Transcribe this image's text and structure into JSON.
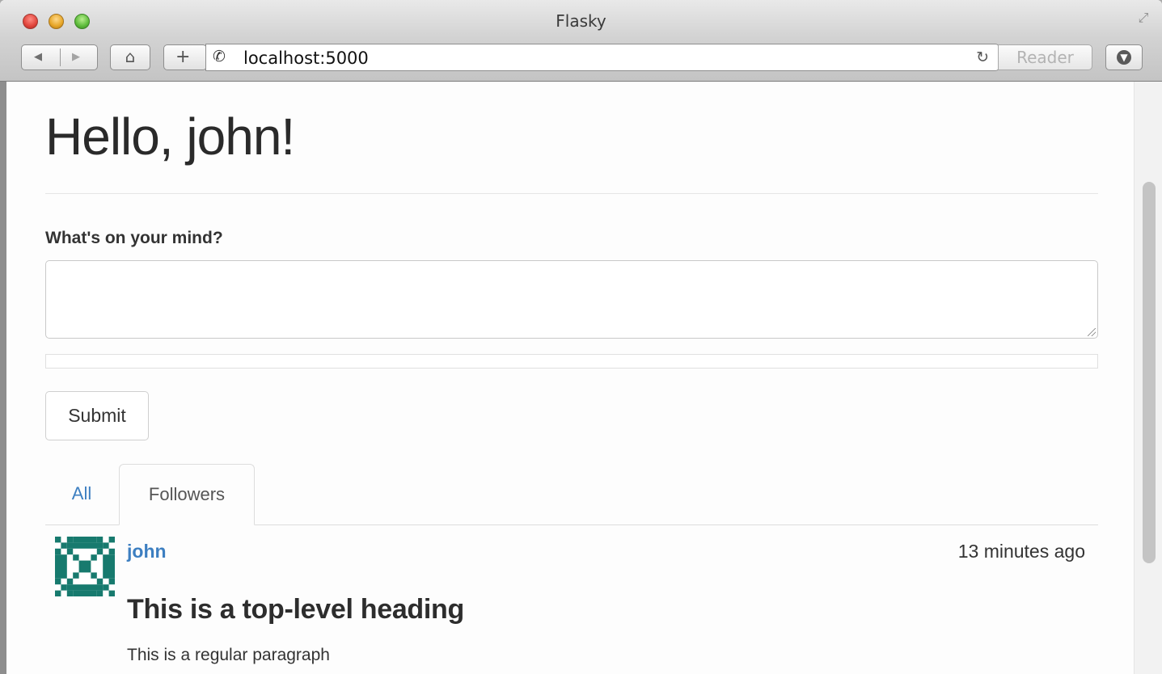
{
  "window": {
    "title": "Flasky",
    "url": "localhost:5000",
    "reader_label": "Reader"
  },
  "icons": {
    "back": "back-arrow-icon",
    "forward": "forward-arrow-icon",
    "home": "home-icon",
    "add": "plus-icon",
    "url": "phone-icon",
    "reload": "reload-icon",
    "download": "download-icon",
    "fullscreen": "fullscreen-icon"
  },
  "page": {
    "title": "Hello, john!",
    "form": {
      "label": "What's on your mind?",
      "textarea_value": "",
      "submit_label": "Submit"
    },
    "tabs": [
      {
        "label": "All",
        "active": false
      },
      {
        "label": "Followers",
        "active": true
      }
    ],
    "post": {
      "author": "john",
      "timestamp": "13 minutes ago",
      "heading": "This is a top-level heading",
      "paragraph": "This is a regular paragraph"
    }
  },
  "colors": {
    "link": "#3d7fc1",
    "avatar": "#177a6e",
    "text": "#333333"
  }
}
